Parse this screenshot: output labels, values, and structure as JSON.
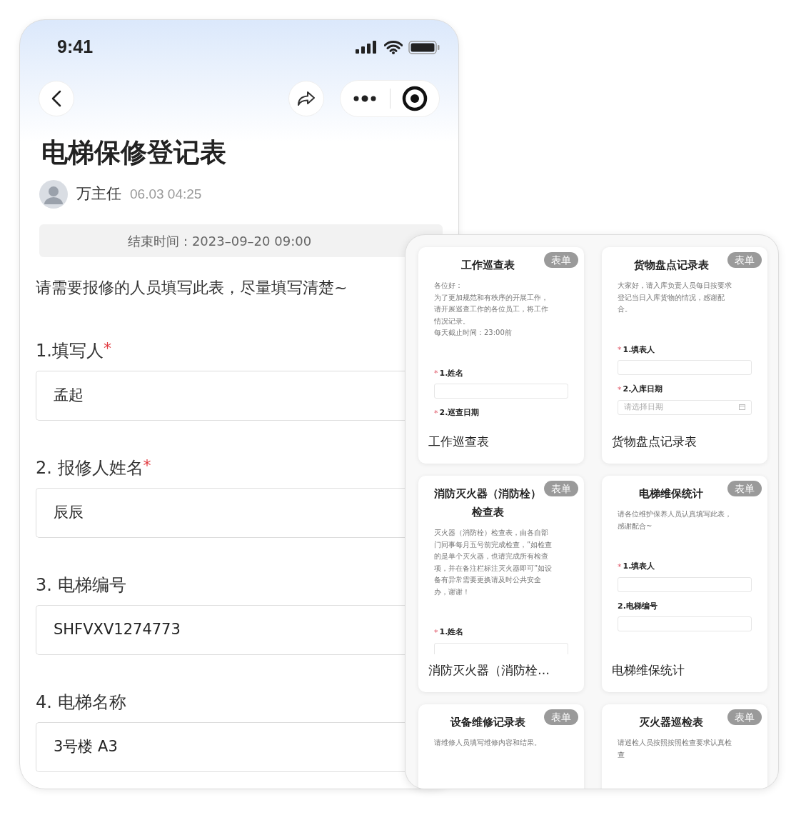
{
  "status_bar": {
    "time": "9:41"
  },
  "form": {
    "title": "电梯保修登记表",
    "author": "万主任",
    "posted": "06.03 04:25",
    "end_time": "结束时间：2023–09–20 09:00",
    "intro": "请需要报修的人员填写此表，尽量填写清楚~",
    "questions": [
      {
        "label": "1.填写人",
        "mark": "*",
        "value": "孟起"
      },
      {
        "label": "2. 报修人姓名",
        "mark": "*",
        "value": "辰辰"
      },
      {
        "label": "3. 电梯编号",
        "value": "SHFVXV1274773"
      },
      {
        "label": "4. 电梯名称",
        "value": "3号楼 A3"
      }
    ]
  },
  "templates": [
    {
      "title": "工作巡查表",
      "badge": "表单",
      "description": [
        "各位好：",
        "为了更加规范和有秩序的开展工作，",
        "请开展巡查工作的各位员工，将工作",
        "情况记录。",
        "每天截止时间：23:00前"
      ],
      "fields": [
        {
          "label": "1.姓名",
          "mark": "*",
          "kind": "text"
        },
        {
          "label": "2.巡查日期",
          "mark": "*",
          "kind": "none"
        }
      ],
      "name": "工作巡查表"
    },
    {
      "title": "货物盘点记录表",
      "badge": "表单",
      "description": [
        "大家好，请入库负责人员每日按要求",
        "登记当日入库货物的情况，感谢配",
        "合。"
      ],
      "fields": [
        {
          "label": "1.填表人",
          "mark": "*",
          "kind": "text"
        },
        {
          "label": "2.入库日期",
          "mark": "*",
          "kind": "date",
          "placeholder": "请选择日期"
        }
      ],
      "name": "货物盘点记录表"
    },
    {
      "title": "消防灭火器（消防栓）检查表",
      "badge": "表单",
      "description": [
        "灭火器（消防栓）检查表，由各自部",
        "门同事每月五号前完成检查，”如检查",
        "的是单个灭火器，也请完成所有检查",
        "项，并在备注栏标注灭火器即可”如设",
        "备有异常需要更换请及时公共安全",
        "办，谢谢！"
      ],
      "fields": [
        {
          "label": "1.姓名",
          "mark": "*",
          "kind": "text"
        }
      ],
      "name": "消防灭火器（消防栓…"
    },
    {
      "title": "电梯维保统计",
      "badge": "表单",
      "description": [
        "请各位维护保养人员认真填写此表，",
        "感谢配合~"
      ],
      "fields": [
        {
          "label": "1.填表人",
          "mark": "*",
          "kind": "text"
        },
        {
          "label": "2.电梯编号",
          "kind": "text"
        }
      ],
      "name": "电梯维保统计"
    },
    {
      "title": "设备维修记录表",
      "badge": "表单",
      "description": [
        "请维修人员填写维修内容和结果。"
      ]
    },
    {
      "title": "灭火器巡检表",
      "badge": "表单",
      "description": [
        "请巡检人员按照按照检查要求认真检",
        "查"
      ]
    }
  ]
}
